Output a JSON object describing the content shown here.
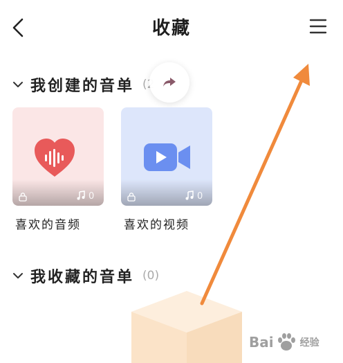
{
  "header": {
    "title": "收藏",
    "back_icon": "chevron-left-icon",
    "menu_icon": "hamburger-menu-icon"
  },
  "sections": {
    "created": {
      "label": "我创建的音单",
      "count": "(2"
    },
    "collected": {
      "label": "我收藏的音单",
      "count": "(0)"
    }
  },
  "playlists": [
    {
      "name": "喜欢的音频",
      "count": "0",
      "icon": "audio-heart-icon",
      "color": "#e85a5a",
      "bg": "#fbe6e6"
    },
    {
      "name": "喜欢的视频",
      "count": "0",
      "icon": "video-camera-icon",
      "color": "#6b8ff0",
      "bg": "#dde6fb"
    }
  ],
  "watermark": {
    "text": "Bai",
    "sub": "经验"
  },
  "colors": {
    "arrow": "#f08a3c"
  }
}
